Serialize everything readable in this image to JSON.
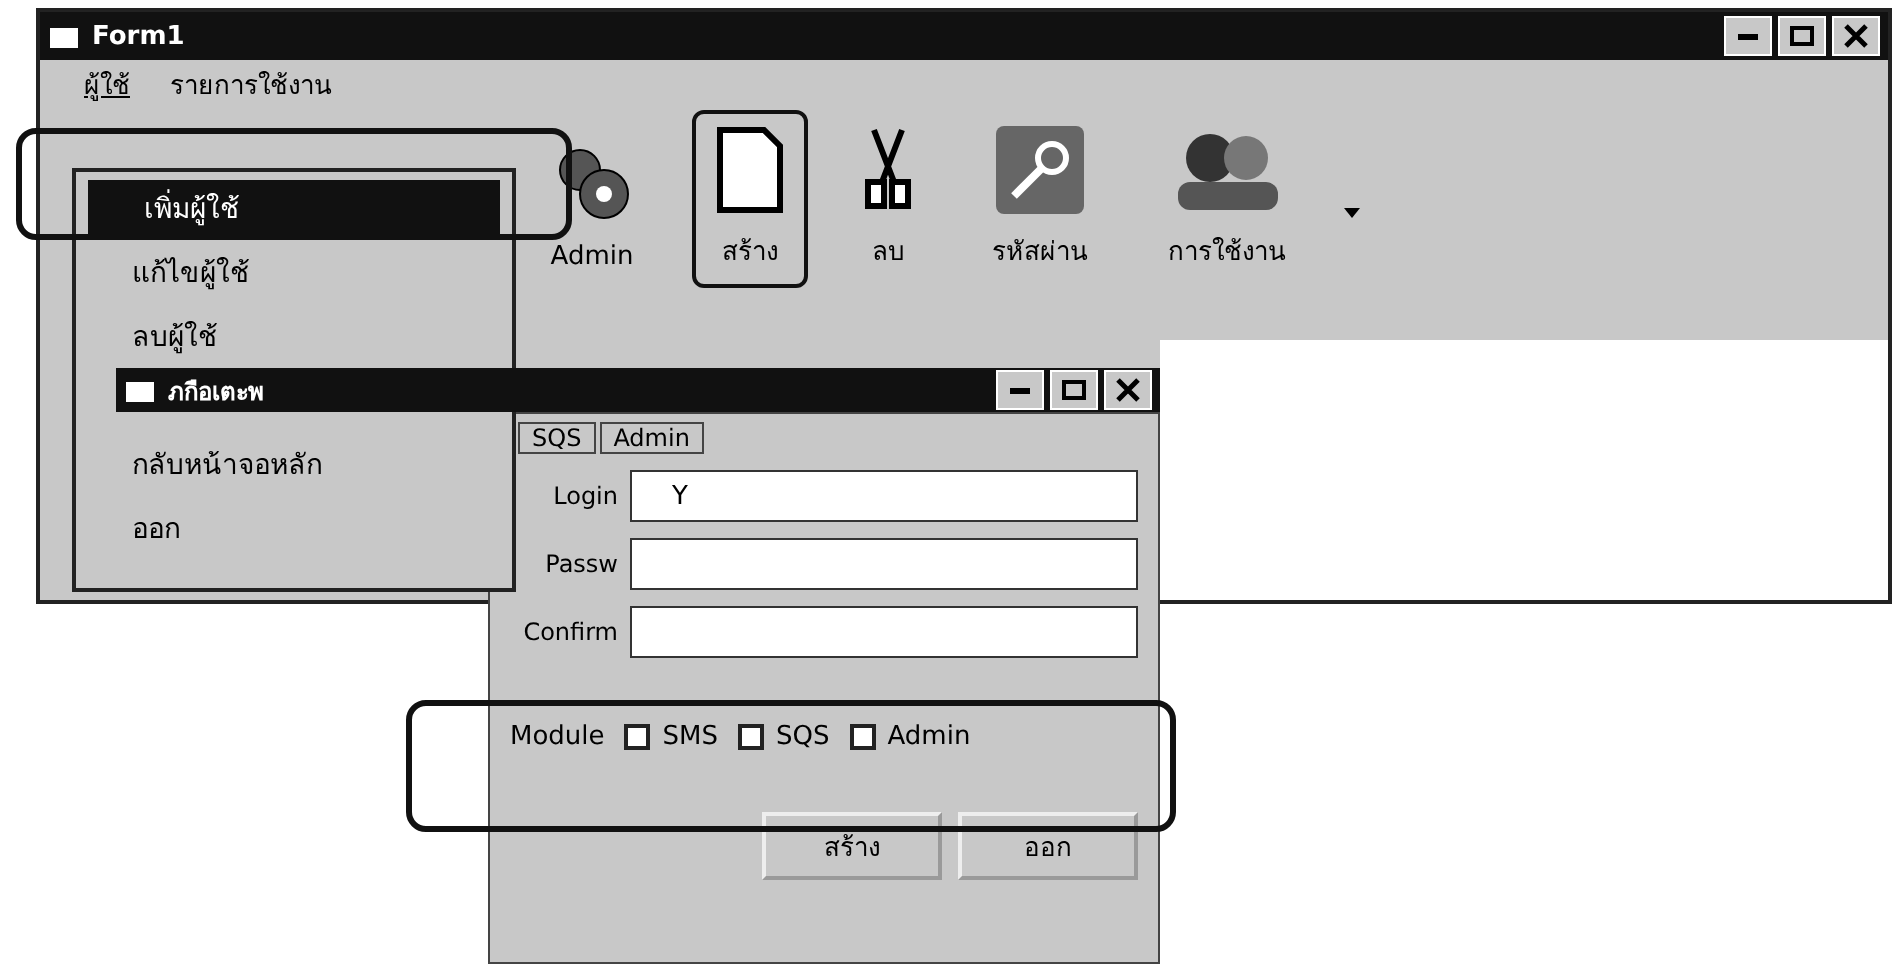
{
  "main_window": {
    "title": "Form1",
    "menu": [
      {
        "label": "ผู้ใช้",
        "selected": true
      },
      {
        "label": "รายการใช้งาน",
        "selected": false
      }
    ],
    "menu_dropdown": [
      {
        "label": "เพิ่มผู้ใช้",
        "selected": true
      },
      {
        "label": "แก้ไขผู้ใช้",
        "selected": false
      },
      {
        "label": "ลบผู้ใช้",
        "selected": false
      },
      {
        "label": "กลับหน้าจอหลัก",
        "selected": false
      },
      {
        "label": "ออก",
        "selected": false
      }
    ],
    "toolbar": [
      {
        "label": "Admin",
        "highlighted": false
      },
      {
        "label": "สร้าง",
        "highlighted": true
      },
      {
        "label": "ลบ",
        "highlighted": false
      },
      {
        "label": "รหัสผ่าน",
        "highlighted": false
      },
      {
        "label": "การใช้งาน",
        "highlighted": false
      }
    ]
  },
  "child_window": {
    "title": "ภกือเตะพ",
    "tabs": [
      "SQS",
      "Admin"
    ],
    "fields": [
      {
        "label": "Login",
        "value": "Y"
      },
      {
        "label": "Passw"
      },
      {
        "label": "Confirm"
      }
    ],
    "module": {
      "label": "Module",
      "options": [
        {
          "label": "SMS",
          "checked": false
        },
        {
          "label": "SQS",
          "checked": false
        },
        {
          "label": "Admin",
          "checked": false
        }
      ]
    },
    "buttons": [
      "สร้าง",
      "ออก"
    ]
  }
}
